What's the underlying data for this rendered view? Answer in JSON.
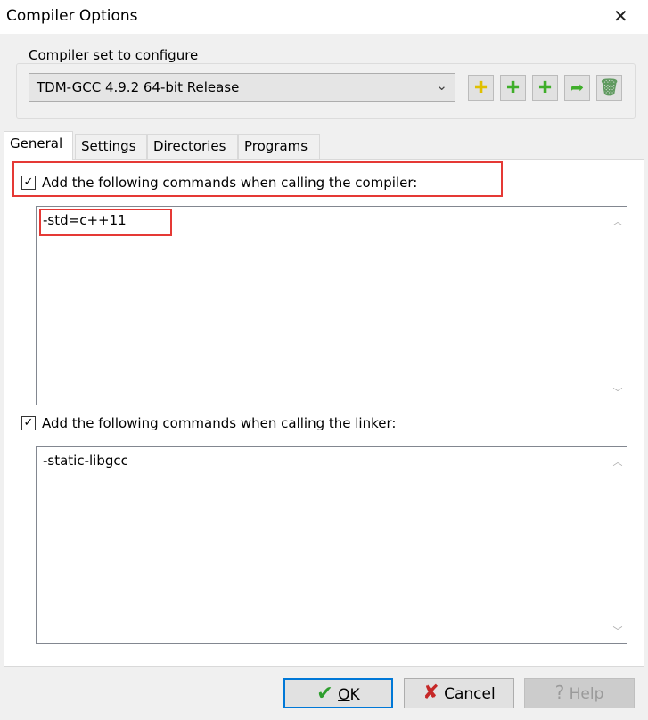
{
  "window": {
    "title": "Compiler Options",
    "close_icon": "close-icon"
  },
  "compiler_set": {
    "label": "Compiler set to configure",
    "selected": "TDM-GCC 4.9.2 64-bit Release",
    "toolbar": [
      "copy-set-icon",
      "add-set-icon",
      "add-from-folder-icon",
      "rename-icon",
      "delete-icon"
    ]
  },
  "tabs": [
    {
      "label": "General",
      "active": true
    },
    {
      "label": "Settings"
    },
    {
      "label": "Directories"
    },
    {
      "label": "Programs"
    }
  ],
  "general": {
    "compiler_cmd_label": "Add the following commands when calling the compiler:",
    "compiler_cmd_checked": true,
    "compiler_cmd_value": "-std=c++11",
    "linker_cmd_label": "Add the following commands when calling the linker:",
    "linker_cmd_checked": true,
    "linker_cmd_value": "-static-libgcc"
  },
  "buttons": {
    "ok_pre": "",
    "ok_u": "O",
    "ok_post": "K",
    "cancel_u": "C",
    "cancel_post": "ancel",
    "help_u": "H",
    "help_post": "elp"
  },
  "colors": {
    "highlight": "#e53935",
    "ok_check": "#2e9e2e",
    "cancel_x": "#c62828"
  }
}
